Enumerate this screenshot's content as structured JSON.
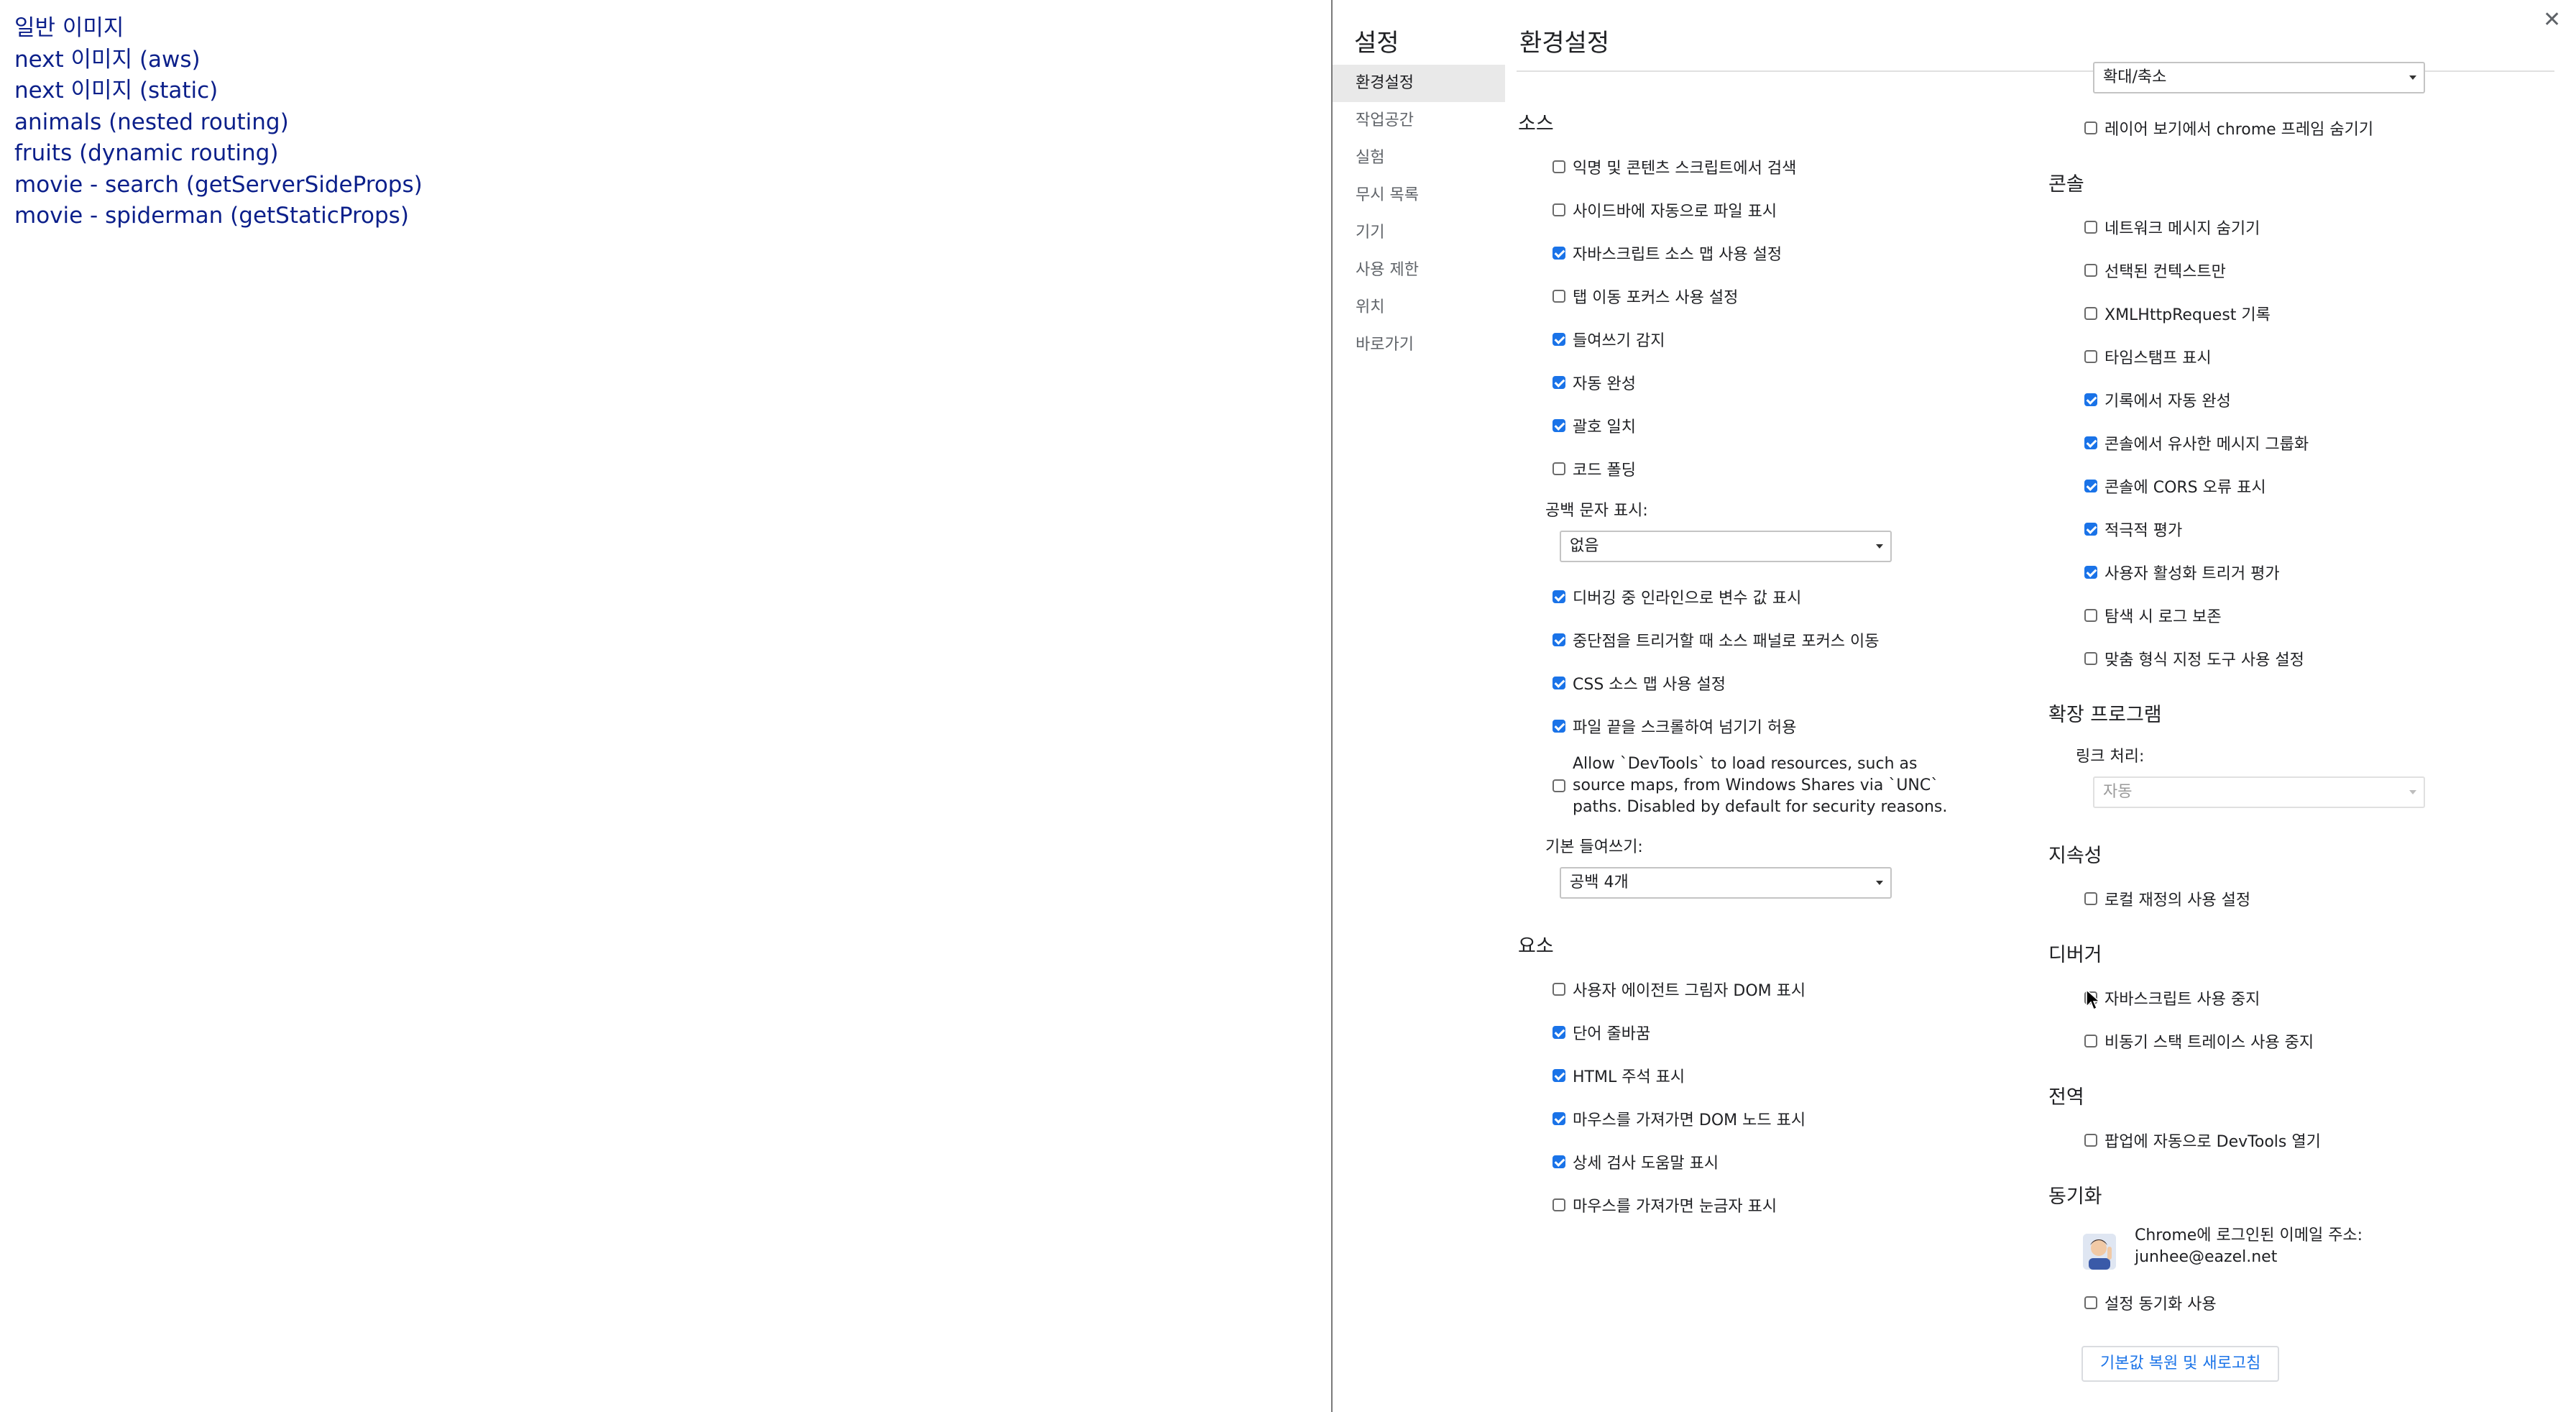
{
  "page": {
    "links": [
      "일반 이미지",
      "next 이미지 (aws)",
      "next 이미지 (static)",
      "animals (nested routing)",
      "fruits (dynamic routing)",
      "movie - search (getServerSideProps)",
      "movie - spiderman (getStaticProps)"
    ]
  },
  "devtools": {
    "title": "설정",
    "close_icon": "✕",
    "nav": [
      "환경설정",
      "작업공간",
      "실험",
      "무시 목록",
      "기기",
      "사용 제한",
      "위치",
      "바로가기"
    ],
    "panel_title": "환경설정",
    "sources": {
      "title": "소스",
      "options": [
        {
          "label": "익명 및 콘텐츠 스크립트에서 검색",
          "checked": false
        },
        {
          "label": "사이드바에 자동으로 파일 표시",
          "checked": false
        },
        {
          "label": "자바스크립트 소스 맵 사용 설정",
          "checked": true
        },
        {
          "label": "탭 이동 포커스 사용 설정",
          "checked": false
        },
        {
          "label": "들여쓰기 감지",
          "checked": true
        },
        {
          "label": "자동 완성",
          "checked": true
        },
        {
          "label": "괄호 일치",
          "checked": true
        },
        {
          "label": "코드 폴딩",
          "checked": false
        }
      ],
      "whitespace_label": "공백 문자 표시:",
      "whitespace_value": "없음",
      "options2": [
        {
          "label": "디버깅 중 인라인으로 변수 값 표시",
          "checked": true
        },
        {
          "label": "중단점을 트리거할 때 소스 패널로 포커스 이동",
          "checked": true
        },
        {
          "label": "CSS 소스 맵 사용 설정",
          "checked": true
        },
        {
          "label": "파일 끝을 스크롤하여 넘기기 허용",
          "checked": true
        }
      ],
      "unc_lines": [
        "Allow `DevTools` to load resources, such as",
        "source maps, from Windows Shares via `UNC`",
        "paths. Disabled by default for security reasons."
      ],
      "unc_checked": false,
      "indent_label": "기본 들여쓰기:",
      "indent_value": "공백 4개"
    },
    "elements": {
      "title": "요소",
      "options": [
        {
          "label": "사용자 에이전트 그림자 DOM 표시",
          "checked": false
        },
        {
          "label": "단어 줄바꿈",
          "checked": true
        },
        {
          "label": "HTML 주석 표시",
          "checked": true
        },
        {
          "label": "마우스를 가져가면 DOM 노드 표시",
          "checked": true
        },
        {
          "label": "상세 검사 도움말 표시",
          "checked": true
        },
        {
          "label": "마우스를 가져가면 눈금자 표시",
          "checked": false
        }
      ]
    },
    "layers": {
      "zoom_value": "확대/축소",
      "hide_frames": {
        "label": "레이어 보기에서 chrome 프레임 숨기기",
        "checked": false
      }
    },
    "console": {
      "title": "콘솔",
      "options": [
        {
          "label": "네트워크 메시지 숨기기",
          "checked": false
        },
        {
          "label": "선택된 컨텍스트만",
          "checked": false
        },
        {
          "label": "XMLHttpRequest 기록",
          "checked": false
        },
        {
          "label": "타임스탬프 표시",
          "checked": false
        },
        {
          "label": "기록에서 자동 완성",
          "checked": true
        },
        {
          "label": "콘솔에서 유사한 메시지 그룹화",
          "checked": true
        },
        {
          "label": "콘솔에 CORS 오류 표시",
          "checked": true
        },
        {
          "label": "적극적 평가",
          "checked": true
        },
        {
          "label": "사용자 활성화 트리거 평가",
          "checked": true
        },
        {
          "label": "탐색 시 로그 보존",
          "checked": false
        },
        {
          "label": "맞춤 형식 지정 도구 사용 설정",
          "checked": false
        }
      ]
    },
    "extensions": {
      "title": "확장 프로그램",
      "link_label": "링크 처리:",
      "link_value": "자동"
    },
    "persistence": {
      "title": "지속성",
      "options": [
        {
          "label": "로컬 재정의 사용 설정",
          "checked": false
        }
      ]
    },
    "debugger": {
      "title": "디버거",
      "options": [
        {
          "label": "자바스크립트 사용 중지",
          "checked": false
        },
        {
          "label": "비동기 스택 트레이스 사용 중지",
          "checked": false
        }
      ]
    },
    "global": {
      "title": "전역",
      "options": [
        {
          "label": "팝업에 자동으로 DevTools 열기",
          "checked": false
        }
      ]
    },
    "sync": {
      "title": "동기화",
      "account_label": "Chrome에 로그인된 이메일 주소:",
      "email": "junhee@eazel.net",
      "sync_option": {
        "label": "설정 동기화 사용",
        "checked": false
      }
    },
    "reset_button": "기본값 복원 및 새로고침"
  }
}
